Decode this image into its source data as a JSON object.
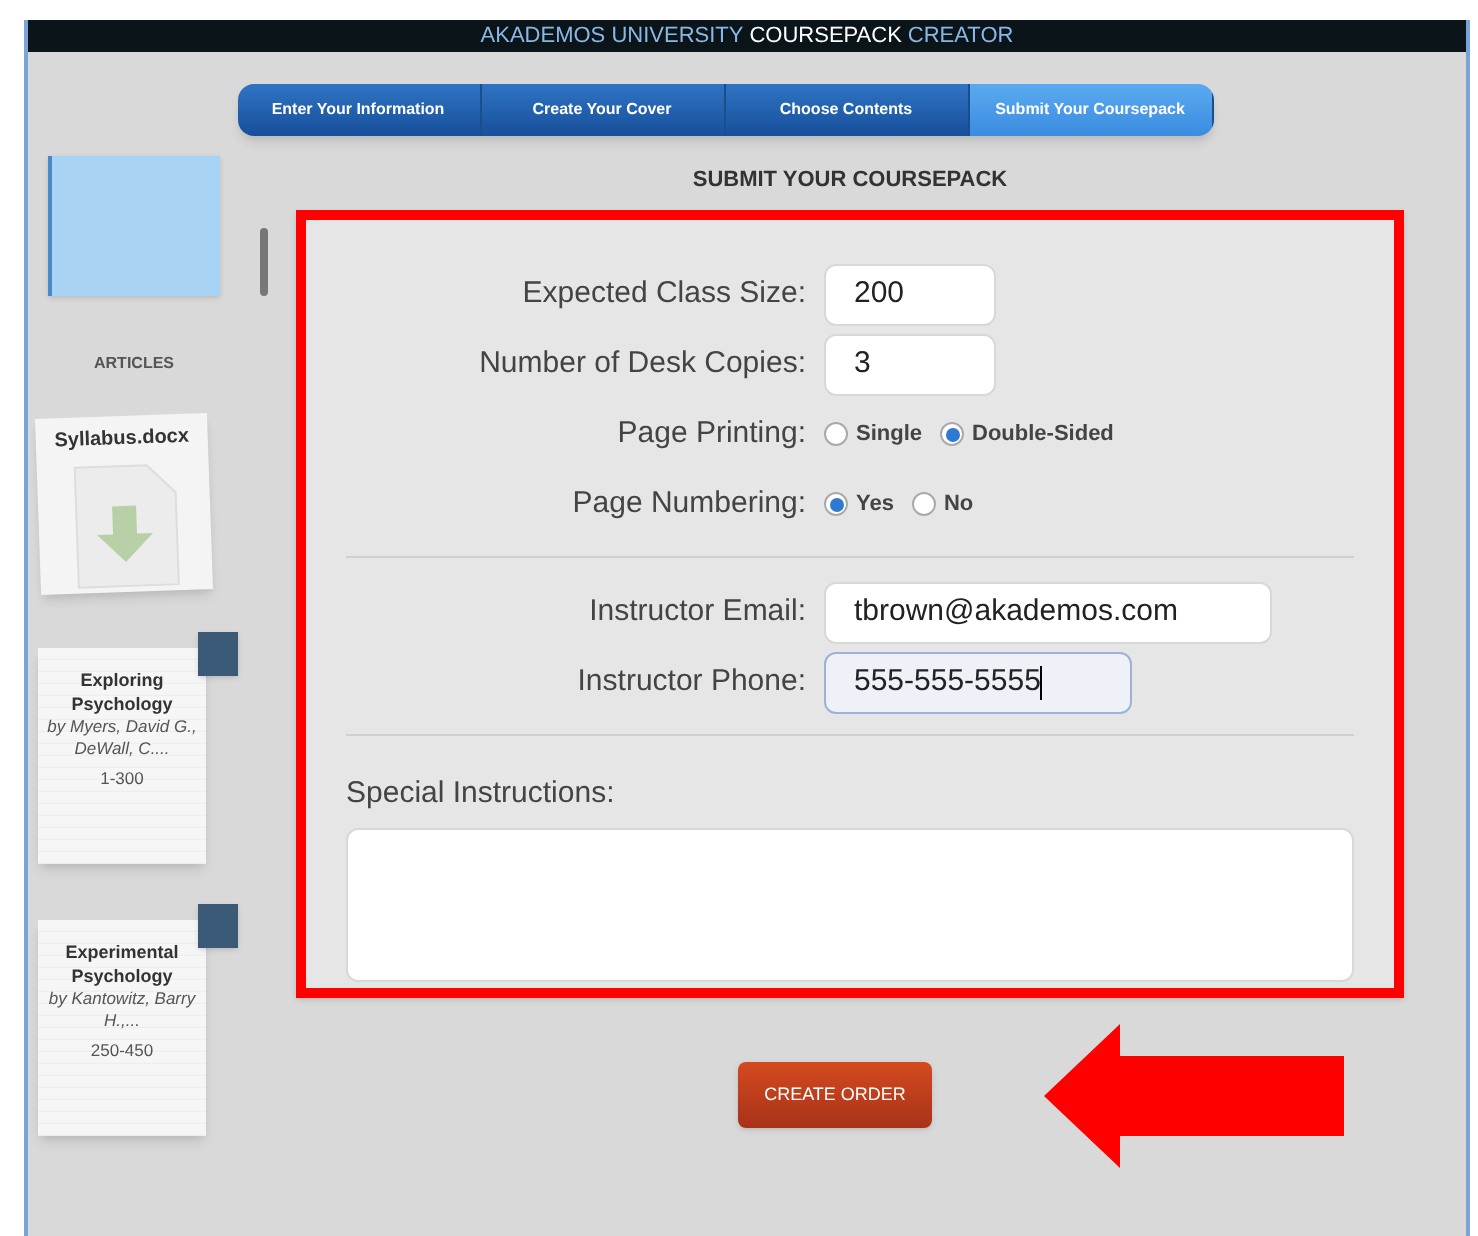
{
  "header": {
    "title_parts": [
      {
        "text": "AKADEMOS UNIVERSITY",
        "emphasized": false
      },
      {
        "text": "COURSEPACK",
        "emphasized": true
      },
      {
        "text": "CREATOR",
        "emphasized": false
      }
    ]
  },
  "steps": [
    {
      "label": "Enter Your Information",
      "selected": false
    },
    {
      "label": "Create Your Cover",
      "selected": false
    },
    {
      "label": "Choose Contents",
      "selected": false
    },
    {
      "label": "Submit Your Coursepack",
      "selected": true
    }
  ],
  "sidebar": {
    "section_label": "ARTICLES",
    "items": [
      {
        "kind": "file",
        "title": "Syllabus.docx"
      },
      {
        "kind": "book",
        "title": "Exploring Psychology",
        "authors": "by Myers, David G., DeWall, C....",
        "pages": "1-300"
      },
      {
        "kind": "book",
        "title": "Experimental Psychology",
        "authors": "by Kantowitz, Barry H.,...",
        "pages": "250-450"
      }
    ]
  },
  "page_title": "SUBMIT YOUR COURSEPACK",
  "form": {
    "groups": [
      [
        {
          "kind": "number",
          "label": "Expected Class Size:",
          "value": "200",
          "focused": false
        },
        {
          "kind": "number",
          "label": "Number of Desk Copies:",
          "value": "3",
          "focused": false
        },
        {
          "kind": "radio",
          "label": "Page Printing:",
          "options": [
            {
              "label": "Single",
              "selected": false
            },
            {
              "label": "Double-Sided",
              "selected": true
            }
          ]
        },
        {
          "kind": "radio",
          "label": "Page Numbering:",
          "options": [
            {
              "label": "Yes",
              "selected": true
            },
            {
              "label": "No",
              "selected": false
            }
          ]
        }
      ],
      [
        {
          "kind": "email",
          "label": "Instructor Email:",
          "value": "tbrown@akademos.com",
          "focused": false
        },
        {
          "kind": "phone",
          "label": "Instructor Phone:",
          "value": "555-555-5555",
          "focused": true
        }
      ]
    ],
    "special_instructions": {
      "label": "Special Instructions:"
    }
  },
  "submit_button": "CREATE ORDER"
}
